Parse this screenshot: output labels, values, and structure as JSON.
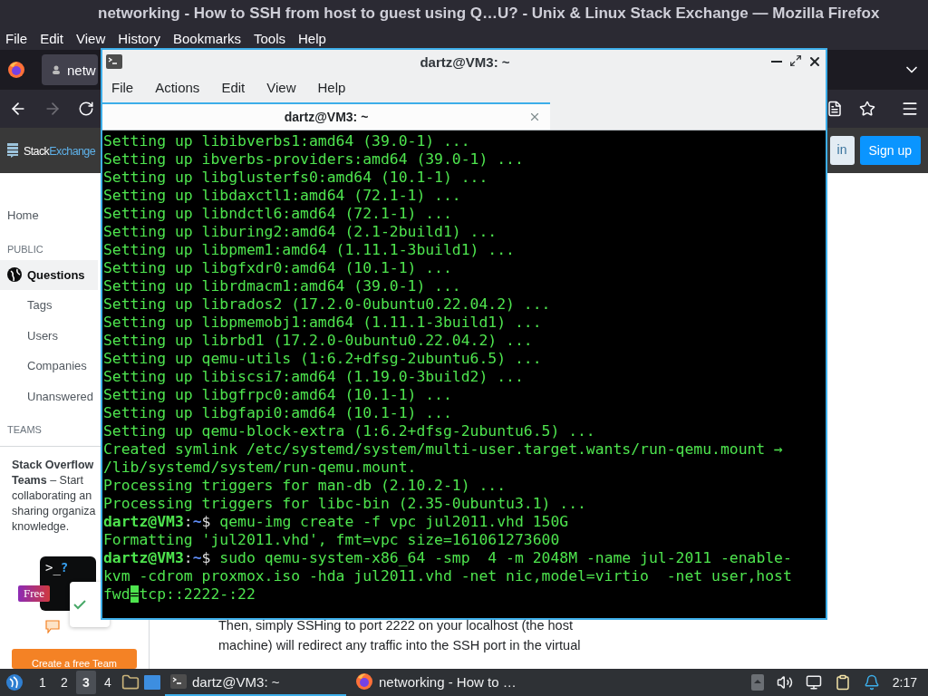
{
  "firefox": {
    "title": "networking - How to SSH from host to guest using Q…U? - Unix & Linux Stack Exchange — Mozilla Firefox",
    "menu": [
      "File",
      "Edit",
      "View",
      "History",
      "Bookmarks",
      "Tools",
      "Help"
    ],
    "tab": {
      "label": "netw"
    },
    "nav": [
      {
        "kind": "back",
        "disabled": false
      },
      {
        "kind": "forward",
        "disabled": true
      },
      {
        "kind": "reload",
        "disabled": false
      }
    ]
  },
  "site_header": {
    "logo_first": "Stack",
    "logo_second": "Exchange",
    "login": "in",
    "signup": "Sign up"
  },
  "sidebar": [
    {
      "kind": "home",
      "label": "Home",
      "selected": false
    },
    {
      "kind": "heading",
      "label": "PUBLIC"
    },
    {
      "kind": "primary",
      "label": "Questions",
      "selected": true
    },
    {
      "kind": "sub",
      "label": "Tags",
      "selected": false
    },
    {
      "kind": "sub",
      "label": "Users",
      "selected": false
    },
    {
      "kind": "sub",
      "label": "Companies",
      "selected": false
    },
    {
      "kind": "sub",
      "label": "Unanswered",
      "selected": false
    },
    {
      "kind": "heading",
      "label": "TEAMS"
    }
  ],
  "teams_card": {
    "lines": [
      "**Stack Overflow**",
      "**Teams** – Start",
      "collaborating an",
      "sharing organiza",
      "knowledge."
    ],
    "prompt_glyph": ">_",
    "question": "?",
    "badge": "Free",
    "cta": "Create a free Team"
  },
  "answer": {
    "lines": [
      "Then, simply SSHing to port 2222 on your localhost (the host",
      "machine) will redirect any traffic into the SSH port in the virtual"
    ]
  },
  "terminal": {
    "title": "dartz@VM3: ~",
    "menu": [
      "File",
      "Actions",
      "Edit",
      "View",
      "Help"
    ],
    "tab": {
      "label": "dartz@VM3: ~",
      "selected": true
    },
    "lines": [
      {
        "kind": "output",
        "text": "Setting up libibverbs1:amd64 (39.0-1) ..."
      },
      {
        "kind": "output",
        "text": "Setting up ibverbs-providers:amd64 (39.0-1) ..."
      },
      {
        "kind": "output",
        "text": "Setting up libglusterfs0:amd64 (10.1-1) ..."
      },
      {
        "kind": "output",
        "text": "Setting up libdaxctl1:amd64 (72.1-1) ..."
      },
      {
        "kind": "output",
        "text": "Setting up libndctl6:amd64 (72.1-1) ..."
      },
      {
        "kind": "output",
        "text": "Setting up liburing2:amd64 (2.1-2build1) ..."
      },
      {
        "kind": "output",
        "text": "Setting up libpmem1:amd64 (1.11.1-3build1) ..."
      },
      {
        "kind": "output",
        "text": "Setting up libgfxdr0:amd64 (10.1-1) ..."
      },
      {
        "kind": "output",
        "text": "Setting up librdmacm1:amd64 (39.0-1) ..."
      },
      {
        "kind": "output",
        "text": "Setting up librados2 (17.2.0-0ubuntu0.22.04.2) ..."
      },
      {
        "kind": "output",
        "text": "Setting up libpmemobj1:amd64 (1.11.1-3build1) ..."
      },
      {
        "kind": "output",
        "text": "Setting up librbd1 (17.2.0-0ubuntu0.22.04.2) ..."
      },
      {
        "kind": "output",
        "text": "Setting up qemu-utils (1:6.2+dfsg-2ubuntu6.5) ..."
      },
      {
        "kind": "output",
        "text": "Setting up libiscsi7:amd64 (1.19.0-3build2) ..."
      },
      {
        "kind": "output",
        "text": "Setting up libgfrpc0:amd64 (10.1-1) ..."
      },
      {
        "kind": "output",
        "text": "Setting up libgfapi0:amd64 (10.1-1) ..."
      },
      {
        "kind": "output",
        "text": "Setting up qemu-block-extra (1:6.2+dfsg-2ubuntu6.5) ..."
      },
      {
        "kind": "output",
        "text": "Created symlink /etc/systemd/system/multi-user.target.wants/run-qemu.mount →"
      },
      {
        "kind": "output",
        "text": "/lib/systemd/system/run-qemu.mount."
      },
      {
        "kind": "output",
        "text": "Processing triggers for man-db (2.10.2-1) ..."
      },
      {
        "kind": "output",
        "text": "Processing triggers for libc-bin (2.35-0ubuntu3.1) ..."
      },
      {
        "kind": "prompt",
        "user": "dartz@VM3",
        "sep": ":",
        "path": "~",
        "sigil": "$",
        "text": "qemu-img create -f vpc jul2011.vhd 150G"
      },
      {
        "kind": "output",
        "text": "Formatting 'jul2011.vhd', fmt=vpc size=161061273600"
      },
      {
        "kind": "prompt",
        "user": "dartz@VM3",
        "sep": ":",
        "path": "~",
        "sigil": "$",
        "text": "sudo qemu-system-x86_64 -smp  4 -m 2048M -name jul-2011 -enable-"
      },
      {
        "kind": "output",
        "text": "kvm -cdrom proxmox.iso -hda jul2011.vhd -net nic,model=virtio  -net user,host"
      },
      {
        "kind": "cursor",
        "before": "fwd",
        "cursor": "=",
        "after": "tcp::2222-:22"
      }
    ]
  },
  "taskbar": {
    "workspaces": [
      {
        "label": "1",
        "selected": false
      },
      {
        "label": "2",
        "selected": false
      },
      {
        "label": "3",
        "selected": true
      },
      {
        "label": "4",
        "selected": false
      }
    ],
    "tasks": [
      {
        "kind": "terminal",
        "label": "dartz@VM3: ~",
        "selected": true
      },
      {
        "kind": "firefox",
        "label": "networking - How to …",
        "selected": false
      }
    ],
    "clock": "2:17"
  }
}
